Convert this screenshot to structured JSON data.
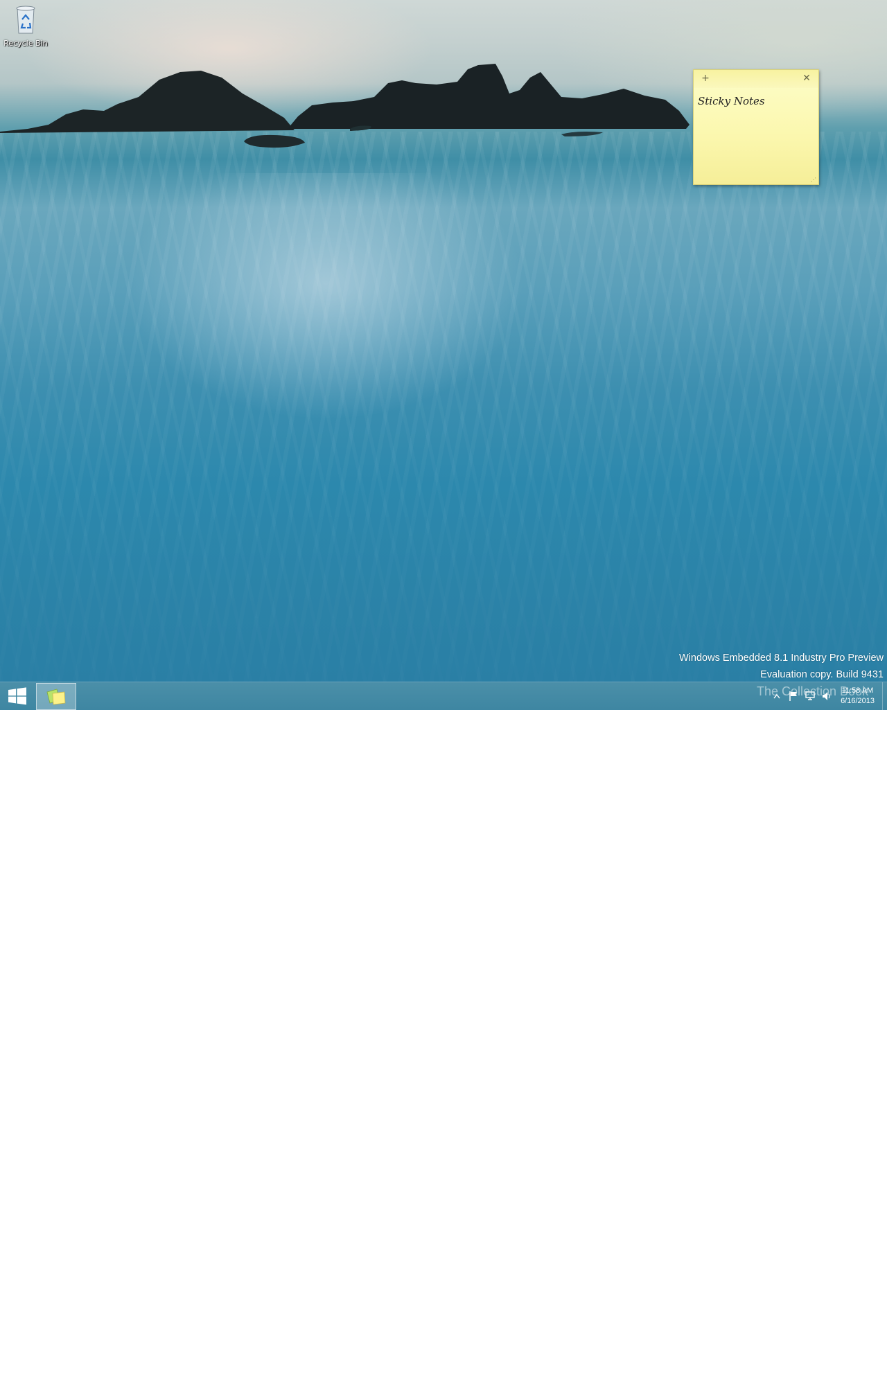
{
  "desktop": {
    "icons": [
      {
        "label": "Recycle Bin",
        "icon": "recycle-bin-icon"
      }
    ]
  },
  "sticky_note": {
    "add_label": "+",
    "close_label": "✕",
    "text": "Sticky Notes"
  },
  "watermark": {
    "line1": "Windows Embedded 8.1 Industry Pro Preview",
    "line2": "Evaluation copy. Build 9431"
  },
  "taskbar": {
    "start_icon": "windows-logo-icon",
    "pinned_apps": [
      {
        "name": "Sticky Notes",
        "icon": "sticky-notes-icon",
        "active": true
      }
    ],
    "tray": {
      "icons": [
        "show-hidden-icons-chevron",
        "action-center-flag-icon",
        "network-icon",
        "volume-icon"
      ],
      "time": "11:58 AM",
      "date": "6/16/2013"
    }
  },
  "overlay": {
    "book_text": "The Collection Book"
  },
  "colors": {
    "taskbar": "#3e86a2",
    "sticky_note": "#fbf7ad",
    "sea": "#2b83a8"
  }
}
